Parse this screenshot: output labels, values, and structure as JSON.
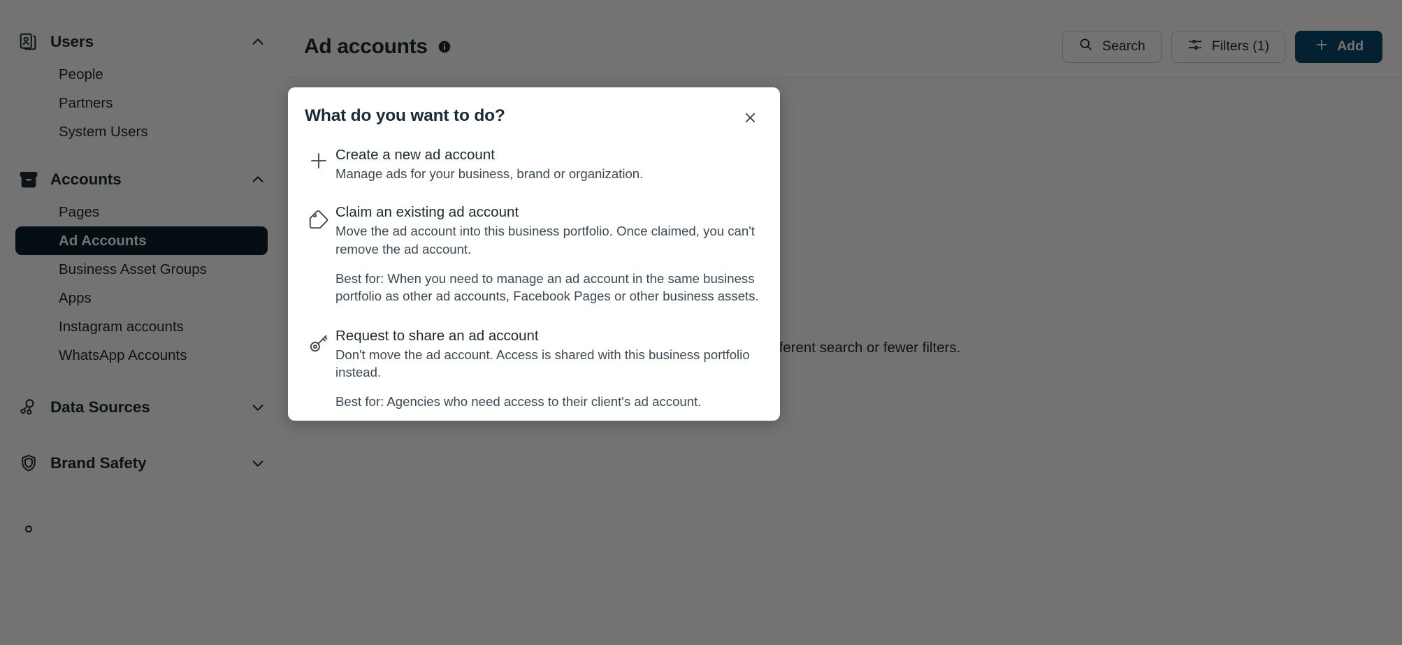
{
  "sidebar": {
    "groups": [
      {
        "label": "Users",
        "icon": "users-card-icon",
        "chevron": "chevron-up-icon",
        "expanded": true,
        "items": [
          {
            "label": "People",
            "selected": false
          },
          {
            "label": "Partners",
            "selected": false
          },
          {
            "label": "System Users",
            "selected": false
          }
        ]
      },
      {
        "label": "Accounts",
        "icon": "archive-box-icon",
        "chevron": "chevron-up-icon",
        "expanded": true,
        "items": [
          {
            "label": "Pages",
            "selected": false
          },
          {
            "label": "Ad Accounts",
            "selected": true
          },
          {
            "label": "Business Asset Groups",
            "selected": false
          },
          {
            "label": "Apps",
            "selected": false
          },
          {
            "label": "Instagram accounts",
            "selected": false
          },
          {
            "label": "WhatsApp Accounts",
            "selected": false
          }
        ]
      },
      {
        "label": "Data Sources",
        "icon": "data-nodes-icon",
        "chevron": "chevron-down-icon",
        "expanded": false,
        "items": []
      },
      {
        "label": "Brand Safety",
        "icon": "shield-icon",
        "chevron": "chevron-down-icon",
        "expanded": false,
        "items": []
      }
    ]
  },
  "header": {
    "title": "Ad accounts",
    "info_icon": "info-circle-icon",
    "search_label": "Search",
    "search_icon": "search-icon",
    "filters_label": "Filters (1)",
    "filters_icon": "sliders-icon",
    "add_label": "Add",
    "add_icon": "plus-icon",
    "add_color": "#0a4a70"
  },
  "empty_state": {
    "subtitle": "Try a different search or fewer filters."
  },
  "modal": {
    "title": "What do you want to do?",
    "close_icon": "close-icon",
    "options": [
      {
        "icon": "plus-icon",
        "title": "Create a new ad account",
        "desc": "Manage ads for your business, brand or organization.",
        "best_for": ""
      },
      {
        "icon": "tag-icon",
        "title": "Claim an existing ad account",
        "desc": "Move the ad account into this business portfolio. Once claimed, you can't remove the ad account.",
        "best_for": "Best for: When you need to manage an ad account in the same business portfolio as other ad accounts, Facebook Pages or other business assets."
      },
      {
        "icon": "key-icon",
        "title": "Request to share an ad account",
        "desc": "Don't move the ad account. Access is shared with this business portfolio instead.",
        "best_for": "Best for: Agencies who need access to their client's ad account."
      }
    ]
  }
}
